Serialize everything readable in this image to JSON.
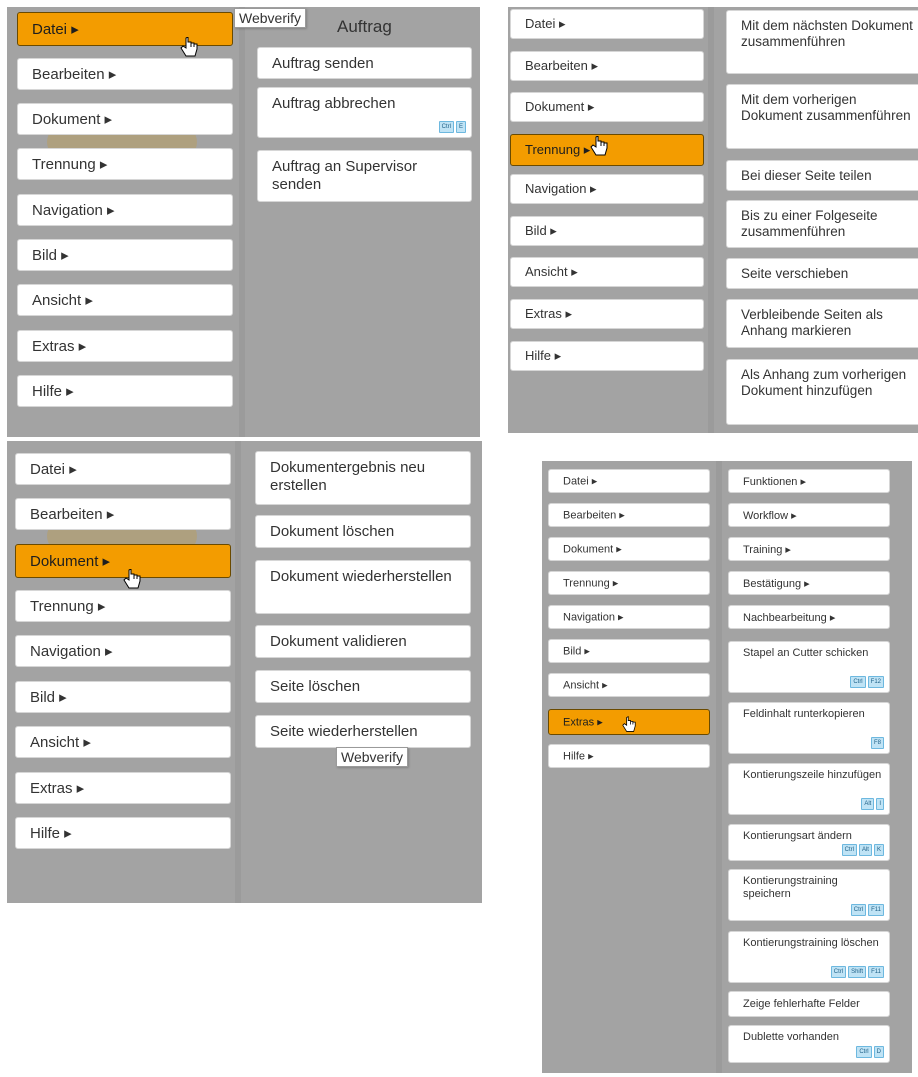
{
  "datei": {
    "menu": [
      "Datei",
      "Bearbeiten",
      "Dokument",
      "Trennung",
      "Navigation",
      "Bild",
      "Ansicht",
      "Extras",
      "Hilfe"
    ],
    "tooltip": "Webverify",
    "header": "Auftrag",
    "items": [
      {
        "label": "Auftrag senden"
      },
      {
        "label": "Auftrag abbrechen",
        "keys": [
          "Ctrl",
          "E"
        ]
      },
      {
        "label": "Auftrag an Supervisor senden"
      }
    ]
  },
  "trennung": {
    "menu": [
      "Datei",
      "Bearbeiten",
      "Dokument",
      "Trennung",
      "Navigation",
      "Bild",
      "Ansicht",
      "Extras",
      "Hilfe"
    ],
    "items": [
      {
        "label": "Mit dem nächsten Dokument zusammenführen"
      },
      {
        "label": "Mit dem vorherigen Dokument zusammenführen"
      },
      {
        "label": "Bei dieser Seite teilen"
      },
      {
        "label": "Bis zu einer Folgeseite zusammenführen"
      },
      {
        "label": "Seite verschieben"
      },
      {
        "label": "Verbleibende Seiten als Anhang markieren"
      },
      {
        "label": "Als Anhang zum vorherigen Dokument hinzufügen"
      }
    ]
  },
  "dokument": {
    "menu": [
      "Datei",
      "Bearbeiten",
      "Dokument",
      "Trennung",
      "Navigation",
      "Bild",
      "Ansicht",
      "Extras",
      "Hilfe"
    ],
    "tooltip": "Webverify",
    "items": [
      {
        "label": "Dokumentergebnis neu erstellen"
      },
      {
        "label": "Dokument löschen"
      },
      {
        "label": "Dokument wiederherstellen"
      },
      {
        "label": "Dokument validieren"
      },
      {
        "label": "Seite löschen"
      },
      {
        "label": "Seite wiederherstellen"
      }
    ]
  },
  "extras": {
    "menu": [
      "Datei",
      "Bearbeiten",
      "Dokument",
      "Trennung",
      "Navigation",
      "Bild",
      "Ansicht",
      "Extras",
      "Hilfe"
    ],
    "items": [
      {
        "label": "Funktionen",
        "sub": true
      },
      {
        "label": "Workflow",
        "sub": true
      },
      {
        "label": "Training",
        "sub": true
      },
      {
        "label": "Bestätigung",
        "sub": true
      },
      {
        "label": "Nachbearbeitung",
        "sub": true
      },
      {
        "label": "Stapel an Cutter schicken",
        "keys": [
          "Ctrl",
          "F12"
        ]
      },
      {
        "label": "Feldinhalt runterkopieren",
        "keys": [
          "F8"
        ]
      },
      {
        "label": "Kontierungszeile hinzufügen",
        "keys": [
          "Alt",
          "I"
        ]
      },
      {
        "label": "Kontierungsart ändern",
        "keys": [
          "Ctrl",
          "Alt",
          "K"
        ]
      },
      {
        "label": "Kontierungstraining speichern",
        "keys": [
          "Ctrl",
          "F11"
        ]
      },
      {
        "label": "Kontierungstraining löschen",
        "keys": [
          "Ctrl",
          "Shift",
          "F11"
        ]
      },
      {
        "label": "Zeige fehlerhafte Felder"
      },
      {
        "label": "Dublette vorhanden",
        "keys": [
          "Ctrl",
          "D"
        ]
      }
    ]
  },
  "icons": {
    "submenu": "submenu-arrow-icon",
    "cursor": "hand-pointer-icon"
  },
  "colors": {
    "active": "#f39c00",
    "panel": "#a3a3a3",
    "key_bg": "#bfe3f5"
  }
}
